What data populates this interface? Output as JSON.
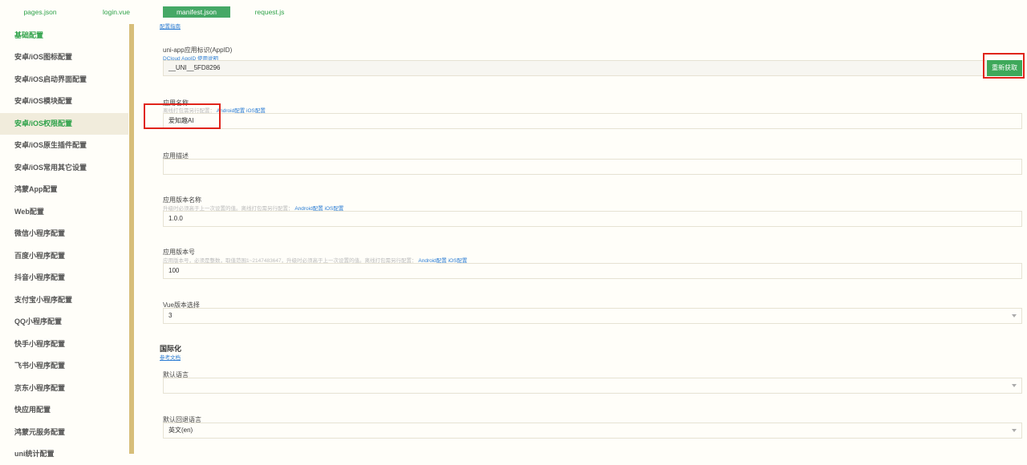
{
  "tabs": [
    {
      "label": "pages.json"
    },
    {
      "label": "login.vue"
    },
    {
      "label": "manifest.json"
    },
    {
      "label": "request.js"
    }
  ],
  "sidebar": {
    "items": [
      {
        "label": "基础配置"
      },
      {
        "label": "安卓/iOS图标配置"
      },
      {
        "label": "安卓/iOS启动界面配置"
      },
      {
        "label": "安卓/iOS模块配置"
      },
      {
        "label": "安卓/iOS权限配置"
      },
      {
        "label": "安卓/iOS原生插件配置"
      },
      {
        "label": "安卓/iOS常用其它设置"
      },
      {
        "label": "鸿蒙App配置"
      },
      {
        "label": "Web配置"
      },
      {
        "label": "微信小程序配置"
      },
      {
        "label": "百度小程序配置"
      },
      {
        "label": "抖音小程序配置"
      },
      {
        "label": "支付宝小程序配置"
      },
      {
        "label": "QQ小程序配置"
      },
      {
        "label": "快手小程序配置"
      },
      {
        "label": "飞书小程序配置"
      },
      {
        "label": "京东小程序配置"
      },
      {
        "label": "快应用配置"
      },
      {
        "label": "鸿蒙元服务配置"
      },
      {
        "label": "uni统计配置"
      }
    ]
  },
  "form": {
    "top_link": "配置指南",
    "appid": {
      "label": "uni-app应用标识(AppID)",
      "link": "DCloud AppID 使用说明",
      "value": "__UNI__5FD8296",
      "button": "重新获取"
    },
    "app_name": {
      "label": "应用名称",
      "hint": "离线打包需另行配置：",
      "android_link": "Android配置",
      "ios_link": "iOS配置",
      "value": "爱知趣AI"
    },
    "app_desc": {
      "label": "应用描述",
      "value": ""
    },
    "version_name": {
      "label": "应用版本名称",
      "hint": "升级时必须高于上一次设置的值。离线打包需另行配置：",
      "android_link": "Android配置",
      "ios_link": "iOS配置",
      "value": "1.0.0"
    },
    "version_code": {
      "label": "应用版本号",
      "hint": "应用版本号，必须是整数，取值范围1~2147483647，升级时必须高于上一次设置的值。离线打包需另行配置：",
      "android_link": "Android配置",
      "ios_link": "iOS配置",
      "value": "100"
    },
    "vue_version": {
      "label": "Vue版本选择",
      "value": "3"
    },
    "i18n": {
      "title": "国际化",
      "link": "参考文档",
      "default_lang_label": "默认语言",
      "default_lang_value": "",
      "fallback_lang_label": "默认回退语言",
      "fallback_lang_value": "英文(en)"
    }
  }
}
